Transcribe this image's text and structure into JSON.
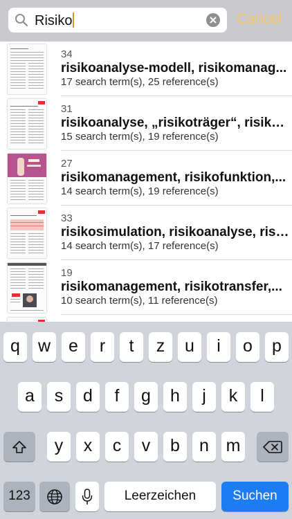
{
  "search": {
    "query": "Risiko",
    "cancel_label": "Cancel"
  },
  "results": [
    {
      "page": "34",
      "title": "risikoanalyse-modell, risikomanag...",
      "meta": "17 search term(s), 25 reference(s)"
    },
    {
      "page": "31",
      "title": "risikoanalyse, „risikoträger“, risiko...",
      "meta": "15 search term(s), 19 reference(s)"
    },
    {
      "page": "27",
      "title": "risikomanagement, risikofunktion,...",
      "meta": "14 search term(s), 19 reference(s)"
    },
    {
      "page": "33",
      "title": "risikosimulation, risikoanalyse, risi...",
      "meta": "14 search term(s), 17 reference(s)"
    },
    {
      "page": "19",
      "title": "risikomanagement, risikotransfer,...",
      "meta": "10 search term(s), 11 reference(s)"
    }
  ],
  "keyboard": {
    "row1": [
      "q",
      "w",
      "e",
      "r",
      "t",
      "z",
      "u",
      "i",
      "o",
      "p"
    ],
    "row2": [
      "a",
      "s",
      "d",
      "f",
      "g",
      "h",
      "j",
      "k",
      "l"
    ],
    "row3": [
      "y",
      "x",
      "c",
      "v",
      "b",
      "n",
      "m"
    ],
    "numbers_label": "123",
    "space_label": "Leerzeichen",
    "search_label": "Suchen"
  },
  "colors": {
    "accent": "#f7c56a",
    "search_key": "#1e7cf2",
    "keyboard_bg": "#d1d4da"
  }
}
